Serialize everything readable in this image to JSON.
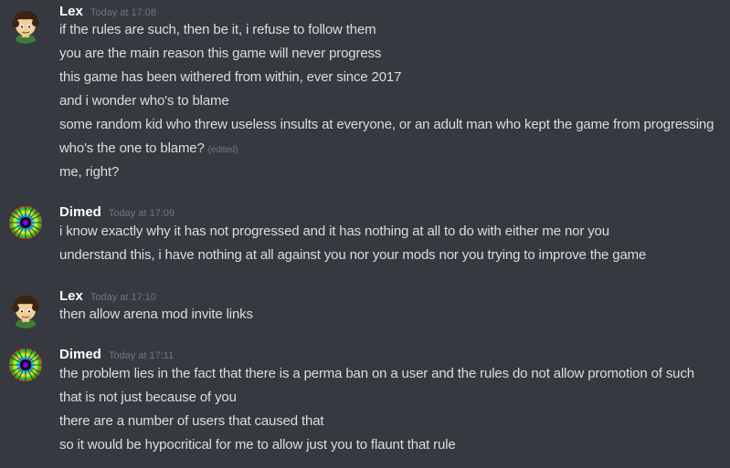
{
  "messages": [
    {
      "author": "Lex",
      "avatar_icon": "cartoon-character-avatar-icon",
      "timestamp": "Today at 17:08",
      "lines": [
        "if the rules are such, then be it, i refuse to follow them",
        "you are the main reason this game will never progress",
        "this game has been withered from within, ever since 2017",
        "and i wonder who's to blame",
        "some random kid who threw useless insults at everyone, or an adult man who kept the game from progressing",
        "who's the one to blame?",
        "me, right?"
      ],
      "edited_label": "(edited)"
    },
    {
      "author": "Dimed",
      "avatar_icon": "rainbow-fractal-avatar-icon",
      "timestamp": "Today at 17:09",
      "lines": [
        "i know exactly why it has not progressed and it has nothing at all to do with either me nor you",
        "understand this, i have nothing at all against you nor your mods nor you trying to improve the game"
      ]
    },
    {
      "author": "Lex",
      "avatar_icon": "cartoon-character-avatar-icon",
      "timestamp": "Today at 17:10",
      "lines": [
        "then allow arena mod invite links"
      ]
    },
    {
      "author": "Dimed",
      "avatar_icon": "rainbow-fractal-avatar-icon",
      "timestamp": "Today at 17:11",
      "lines": [
        "the problem lies in the fact that there is a perma ban on a user and the rules do not allow promotion of such",
        "that is not just because of you",
        "there are a number of users that caused that",
        "so it would be hypocritical for me to allow just you to flaunt that rule"
      ]
    }
  ],
  "colors": {
    "background": "#36393f",
    "username": "#ffffff",
    "text": "#dcddde",
    "muted": "#72767d"
  }
}
